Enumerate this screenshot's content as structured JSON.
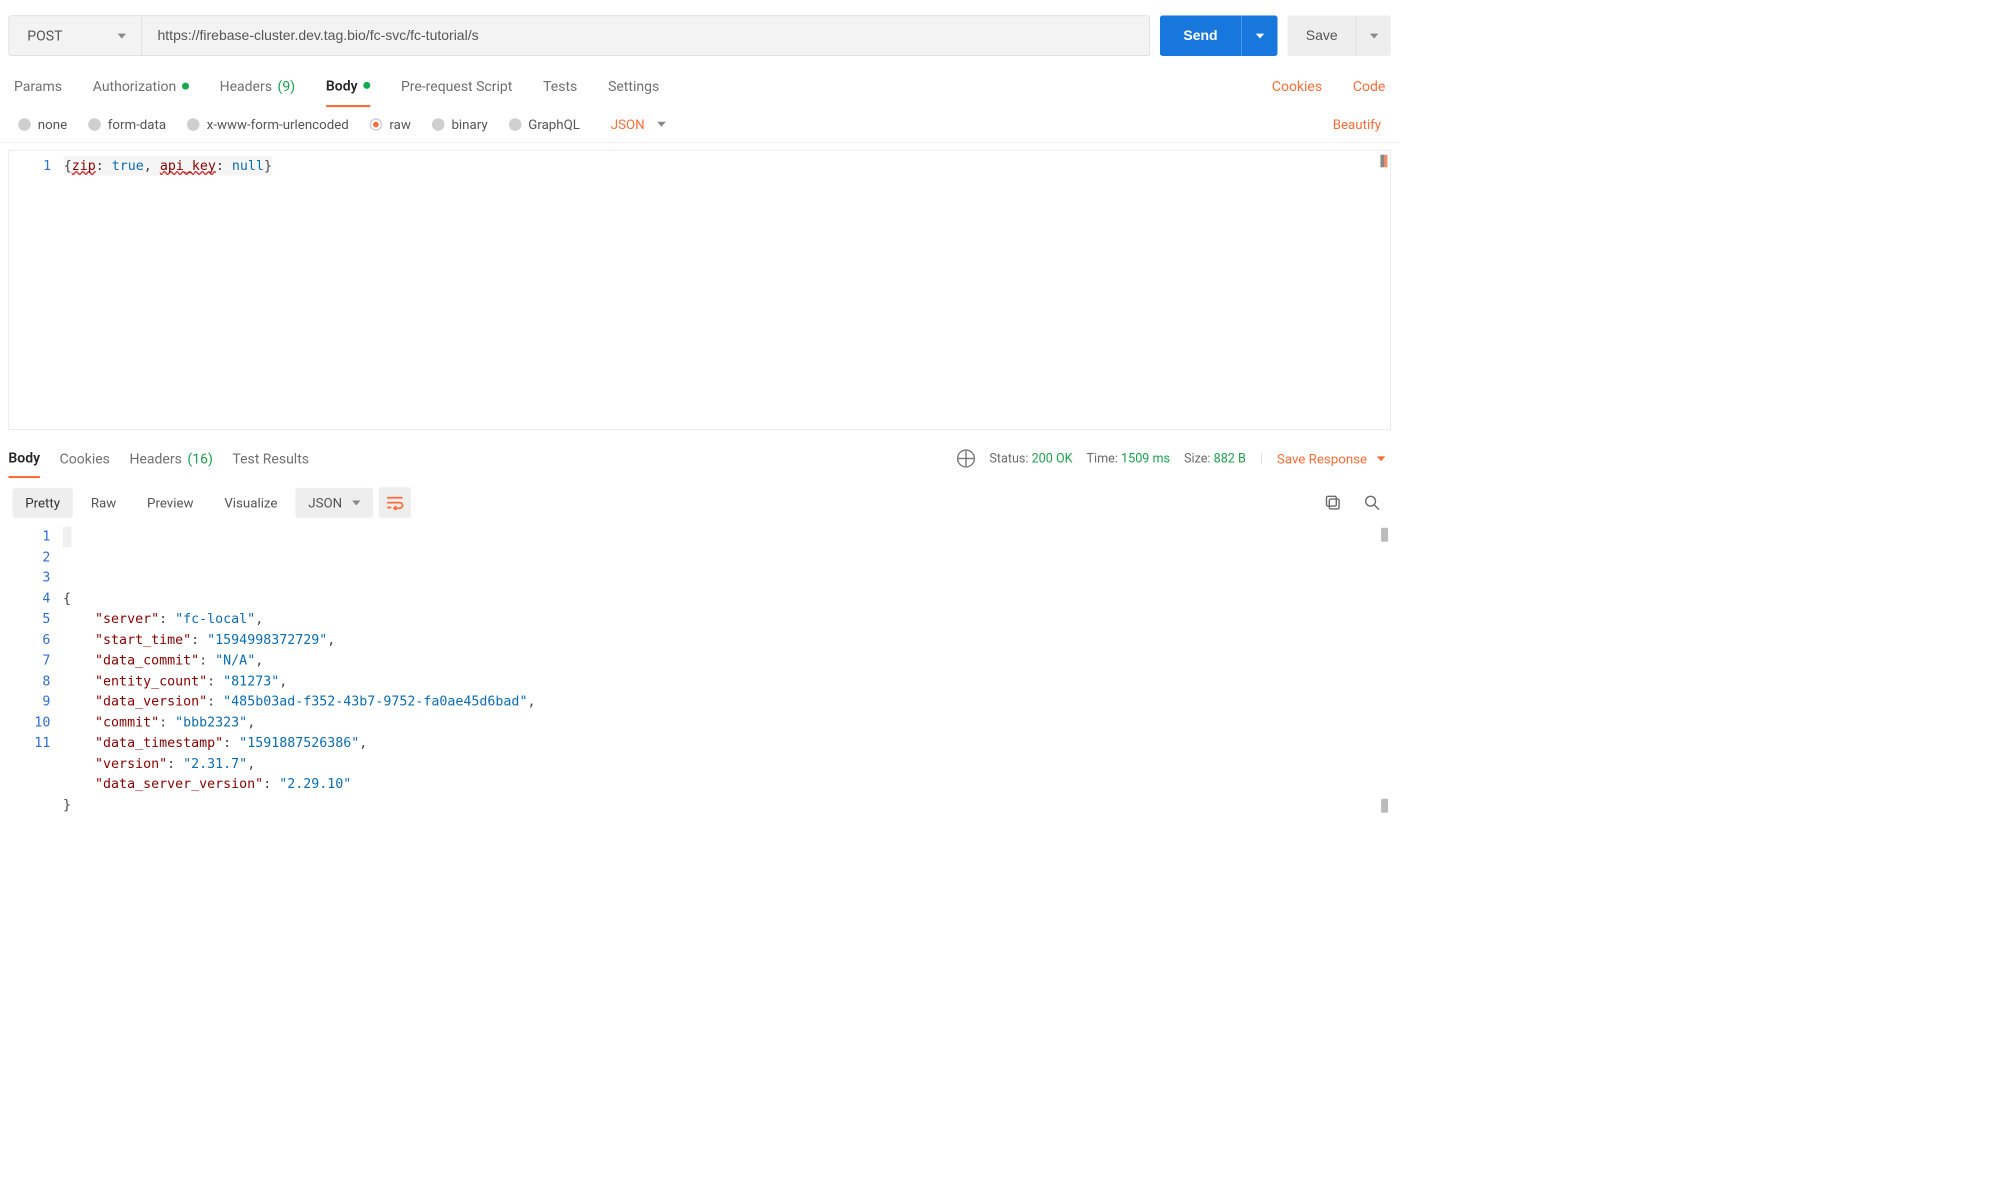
{
  "request": {
    "method": "POST",
    "url": "https://firebase-cluster.dev.tag.bio/fc-svc/fc-tutorial/s",
    "send_label": "Send",
    "save_label": "Save"
  },
  "tabs": {
    "items": [
      "Params",
      "Authorization",
      "Headers",
      "Body",
      "Pre-request Script",
      "Tests",
      "Settings"
    ],
    "headers_count": "(9)",
    "active": "Body",
    "auth_dot": true,
    "body_dot": true,
    "right_links": [
      "Cookies",
      "Code"
    ]
  },
  "body_types": {
    "options": [
      "none",
      "form-data",
      "x-www-form-urlencoded",
      "raw",
      "binary",
      "GraphQL"
    ],
    "selected": "raw",
    "format": "JSON",
    "beautify_label": "Beautify"
  },
  "request_body_text": "{zip: true, api_key: null}",
  "request_body_tokens": [
    {
      "t": "{",
      "c": "punc"
    },
    {
      "t": "zip",
      "c": "key",
      "spell": true
    },
    {
      "t": ": ",
      "c": "punc"
    },
    {
      "t": "true",
      "c": "kw"
    },
    {
      "t": ", ",
      "c": "punc"
    },
    {
      "t": "api_key",
      "c": "key",
      "spell": true
    },
    {
      "t": ": ",
      "c": "punc"
    },
    {
      "t": "null",
      "c": "kw"
    },
    {
      "t": "}",
      "c": "punc"
    }
  ],
  "response": {
    "tabs": [
      "Body",
      "Cookies",
      "Headers",
      "Test Results"
    ],
    "headers_count": "(16)",
    "active": "Body",
    "status_label": "Status:",
    "status_value": "200 OK",
    "time_label": "Time:",
    "time_value": "1509 ms",
    "size_label": "Size:",
    "size_value": "882 B",
    "save_response_label": "Save Response"
  },
  "response_toolbar": {
    "modes": [
      "Pretty",
      "Raw",
      "Preview",
      "Visualize"
    ],
    "active": "Pretty",
    "format": "JSON"
  },
  "response_json": {
    "server": "fc-local",
    "start_time": "1594998372729",
    "data_commit": "N/A",
    "entity_count": "81273",
    "data_version": "485b03ad-f352-43b7-9752-fa0ae45d6bad",
    "commit": "bbb2323",
    "data_timestamp": "1591887526386",
    "version": "2.31.7",
    "data_server_version": "2.29.10"
  }
}
